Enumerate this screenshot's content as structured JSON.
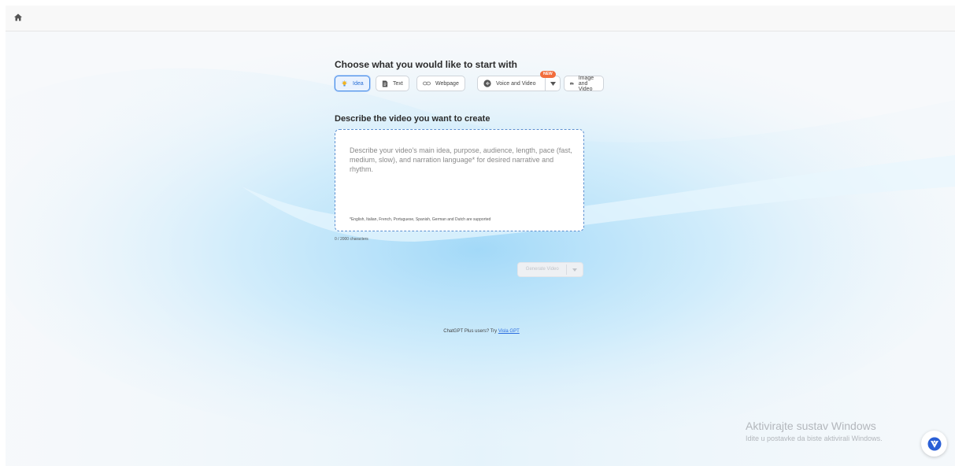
{
  "header": {
    "home_icon": "home-icon"
  },
  "choose": {
    "heading": "Choose what you would like to start with",
    "tabs": [
      {
        "label": "Idea",
        "icon": "lightbulb-icon",
        "active": true
      },
      {
        "label": "Text",
        "icon": "document-icon",
        "active": false
      },
      {
        "label": "Webpage",
        "icon": "link-icon",
        "active": false
      },
      {
        "label": "Voice and Video",
        "icon": "voice-icon",
        "active": false
      },
      {
        "label": "Image and Video",
        "icon": "image-icon",
        "active": false
      }
    ],
    "new_badge": "NEW"
  },
  "describe": {
    "heading": "Describe the video you want to create",
    "placeholder": "Describe your video's main idea, purpose, audience, length, pace (fast, medium, slow), and narration language* for desired narrative and rhythm.",
    "note": "*English, Italian, French, Portuguese, Spanish, German and Dutch are supported",
    "counter": "0 / 2000 characters"
  },
  "generate": {
    "label": "Generate Video"
  },
  "promo": {
    "text": "ChatGPT Plus users? Try ",
    "link": "Visla GPT"
  },
  "windows": {
    "title": "Aktivirajte sustav Windows",
    "subtitle": "Idite u postavke da biste aktivirali Windows."
  },
  "colors": {
    "accent": "#4a8fe6",
    "badge": "#f26d3d",
    "bg_wave": "#bfe4fb"
  }
}
